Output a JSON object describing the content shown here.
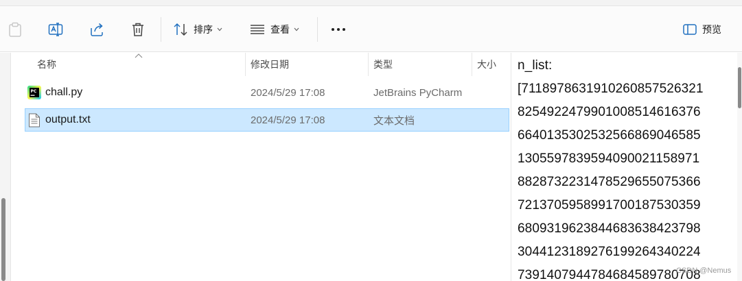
{
  "toolbar": {
    "sort_label": "排序",
    "view_label": "查看",
    "more_label": "•••",
    "preview_label": "预览"
  },
  "header": {
    "name": "名称",
    "date": "修改日期",
    "type": "类型",
    "size": "大小"
  },
  "files": [
    {
      "name": "chall.py",
      "date": "2024/5/29 17:08",
      "type": "JetBrains PyCharm",
      "icon": "pycharm-file-icon"
    },
    {
      "name": "output.txt",
      "date": "2024/5/29 17:08",
      "type": "文本文档",
      "icon": "text-file-icon",
      "selected": true
    }
  ],
  "preview": {
    "lines": [
      "n_list:",
      "[7118978631910260857526321",
      "8254922479901008514616376",
      "6640135302532566869046585",
      "1305597839594090021158971",
      "8828732231478529655075366",
      "7213705958991700187530359",
      "6809319623844683638423798",
      "3044123189276199264340224",
      "7391407944784684589780708"
    ]
  },
  "watermark": "CSDN @Nemus",
  "colors": {
    "selection_bg": "#cce8ff",
    "selection_border": "#99d1ff",
    "accent": "#0067c0"
  }
}
